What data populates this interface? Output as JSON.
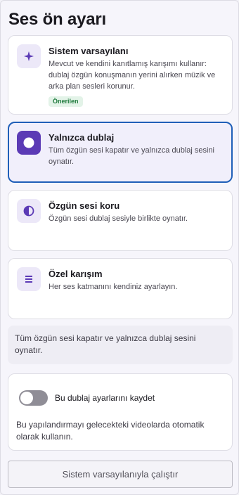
{
  "page": {
    "title": "Ses ön ayarı"
  },
  "options": [
    {
      "title": "Sistem varsayılanı",
      "description": "Mevcut ve kendini kanıtlamış karışımı kullanır: dublaj özgün konuşmanın yerini alırken müzik ve arka plan sesleri korunur.",
      "badge": "Önerilen",
      "icon": "sparkle-icon",
      "selected": false
    },
    {
      "title": "Yalnızca dublaj",
      "description": "Tüm özgün sesi kapatır ve yalnızca dublaj sesini oynatır.",
      "icon": "circle-icon",
      "selected": true
    },
    {
      "title": "Özgün sesi koru",
      "description": "Özgün sesi dublaj sesiyle birlikte oynatır.",
      "icon": "half-circle-icon",
      "selected": false
    },
    {
      "title": "Özel karışım",
      "description": "Her ses katmanını kendiniz ayarlayın.",
      "icon": "sliders-icon",
      "selected": false
    }
  ],
  "info": {
    "text": "Tüm özgün sesi kapatır ve yalnızca dublaj sesini oynatır."
  },
  "save": {
    "toggle_label": "Bu dublaj ayarlarını kaydet",
    "toggle_on": false,
    "description": "Bu yapılandırmayı gelecekteki videolarda otomatik olarak kullanın."
  },
  "footer": {
    "run_label": "Sistem varsayılanıyla çalıştır"
  },
  "colors": {
    "accent": "#5b3ab5",
    "selected_border": "#1f5fb8",
    "badge_bg": "#e3f3e8",
    "badge_text": "#1e7a3c"
  }
}
